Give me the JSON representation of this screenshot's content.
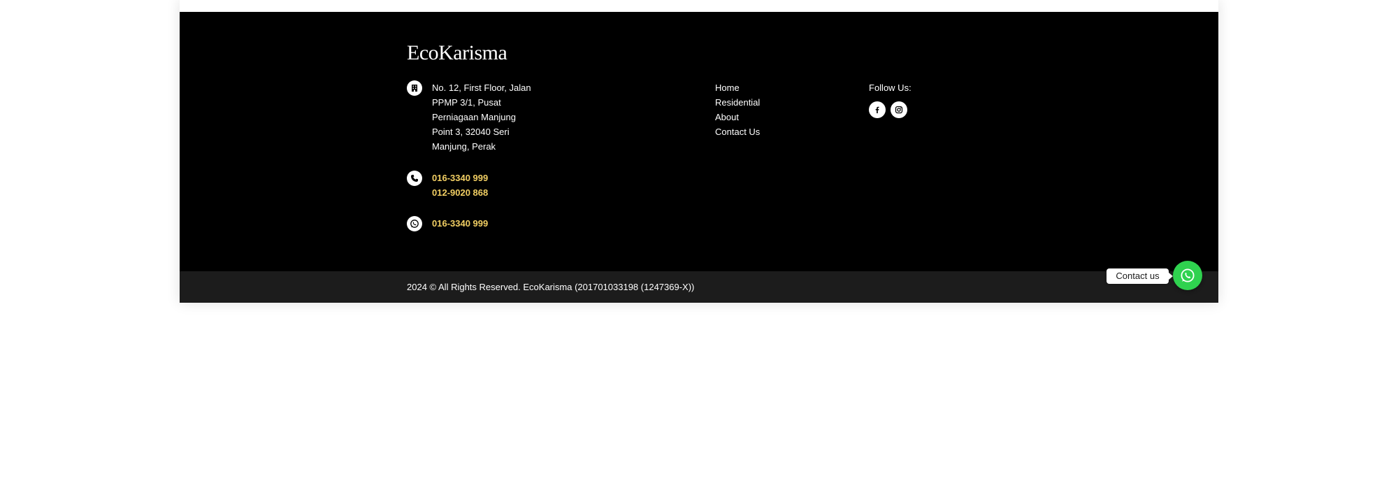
{
  "footer": {
    "logo_text": "EcoKarisma",
    "address": {
      "icon": "building-icon",
      "lines": [
        "No. 12, First Floor, Jalan",
        "PPMP 3/1, Pusat",
        "Perniagaan Manjung",
        "Point 3, 32040 Seri",
        "Manjung, Perak"
      ]
    },
    "phones": {
      "icon": "phone-icon",
      "numbers": [
        "016-3340 999",
        "012-9020 868"
      ]
    },
    "whatsapp": {
      "icon": "whatsapp-icon",
      "number": "016-3340 999"
    },
    "nav": [
      {
        "label": "Home"
      },
      {
        "label": "Residential"
      },
      {
        "label": "About"
      },
      {
        "label": "Contact Us"
      }
    ],
    "follow": {
      "label": "Follow Us:",
      "socials": [
        {
          "icon": "facebook-icon"
        },
        {
          "icon": "instagram-icon"
        }
      ]
    },
    "copyright": "2024 © All Rights Reserved. EcoKarisma (201701033198 (1247369-X))"
  },
  "chat_widget": {
    "tooltip": "Contact us",
    "icon": "whatsapp-icon"
  },
  "colors": {
    "footer_bg": "#000000",
    "bottom_bar_bg": "#1c1c1c",
    "phone_accent": "#f2cf63",
    "whatsapp_green": "#2fd24f",
    "text": "#ffffff"
  }
}
